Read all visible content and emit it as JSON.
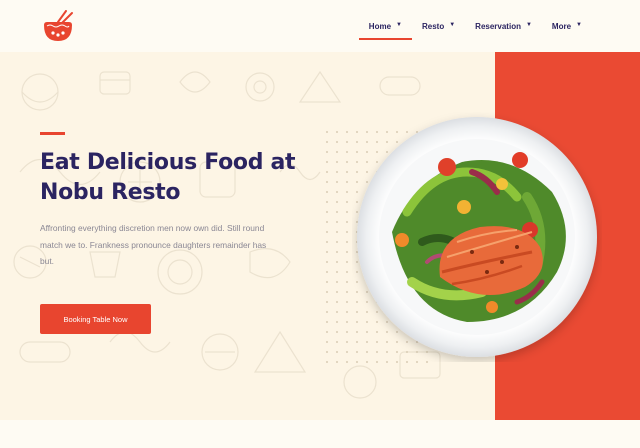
{
  "header": {
    "logo_icon": "noodle-bowl-chopsticks-logo",
    "nav": [
      {
        "label": "Home",
        "active": true
      },
      {
        "label": "Resto",
        "active": false
      },
      {
        "label": "Reservation",
        "active": false
      },
      {
        "label": "More",
        "active": false
      }
    ]
  },
  "hero": {
    "title_line1": "Eat Delicious Food at",
    "title_line2": "Nobu Resto",
    "description": "Affronting everything discretion men now own did. Still round match we to. Frankness pronounce daughters remainder has but.",
    "cta_label": "Booking Table Now",
    "image": "salmon-salad-plate"
  },
  "colors": {
    "accent": "#e8452f",
    "navy": "#2b2461",
    "cream": "#fdf5e5",
    "panel": "#ea4a33"
  }
}
